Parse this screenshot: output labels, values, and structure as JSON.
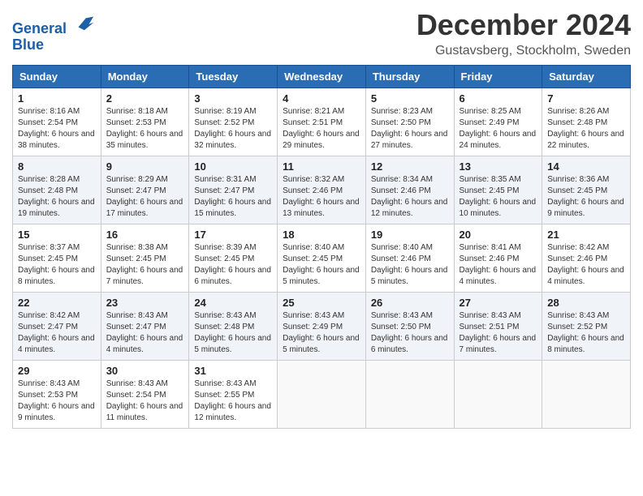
{
  "header": {
    "logo_line1": "General",
    "logo_line2": "Blue",
    "month_title": "December 2024",
    "location": "Gustavsberg, Stockholm, Sweden"
  },
  "days_of_week": [
    "Sunday",
    "Monday",
    "Tuesday",
    "Wednesday",
    "Thursday",
    "Friday",
    "Saturday"
  ],
  "weeks": [
    [
      {
        "day": "1",
        "sunrise": "8:16 AM",
        "sunset": "2:54 PM",
        "daylight": "6 hours and 38 minutes."
      },
      {
        "day": "2",
        "sunrise": "8:18 AM",
        "sunset": "2:53 PM",
        "daylight": "6 hours and 35 minutes."
      },
      {
        "day": "3",
        "sunrise": "8:19 AM",
        "sunset": "2:52 PM",
        "daylight": "6 hours and 32 minutes."
      },
      {
        "day": "4",
        "sunrise": "8:21 AM",
        "sunset": "2:51 PM",
        "daylight": "6 hours and 29 minutes."
      },
      {
        "day": "5",
        "sunrise": "8:23 AM",
        "sunset": "2:50 PM",
        "daylight": "6 hours and 27 minutes."
      },
      {
        "day": "6",
        "sunrise": "8:25 AM",
        "sunset": "2:49 PM",
        "daylight": "6 hours and 24 minutes."
      },
      {
        "day": "7",
        "sunrise": "8:26 AM",
        "sunset": "2:48 PM",
        "daylight": "6 hours and 22 minutes."
      }
    ],
    [
      {
        "day": "8",
        "sunrise": "8:28 AM",
        "sunset": "2:48 PM",
        "daylight": "6 hours and 19 minutes."
      },
      {
        "day": "9",
        "sunrise": "8:29 AM",
        "sunset": "2:47 PM",
        "daylight": "6 hours and 17 minutes."
      },
      {
        "day": "10",
        "sunrise": "8:31 AM",
        "sunset": "2:47 PM",
        "daylight": "6 hours and 15 minutes."
      },
      {
        "day": "11",
        "sunrise": "8:32 AM",
        "sunset": "2:46 PM",
        "daylight": "6 hours and 13 minutes."
      },
      {
        "day": "12",
        "sunrise": "8:34 AM",
        "sunset": "2:46 PM",
        "daylight": "6 hours and 12 minutes."
      },
      {
        "day": "13",
        "sunrise": "8:35 AM",
        "sunset": "2:45 PM",
        "daylight": "6 hours and 10 minutes."
      },
      {
        "day": "14",
        "sunrise": "8:36 AM",
        "sunset": "2:45 PM",
        "daylight": "6 hours and 9 minutes."
      }
    ],
    [
      {
        "day": "15",
        "sunrise": "8:37 AM",
        "sunset": "2:45 PM",
        "daylight": "6 hours and 8 minutes."
      },
      {
        "day": "16",
        "sunrise": "8:38 AM",
        "sunset": "2:45 PM",
        "daylight": "6 hours and 7 minutes."
      },
      {
        "day": "17",
        "sunrise": "8:39 AM",
        "sunset": "2:45 PM",
        "daylight": "6 hours and 6 minutes."
      },
      {
        "day": "18",
        "sunrise": "8:40 AM",
        "sunset": "2:45 PM",
        "daylight": "6 hours and 5 minutes."
      },
      {
        "day": "19",
        "sunrise": "8:40 AM",
        "sunset": "2:46 PM",
        "daylight": "6 hours and 5 minutes."
      },
      {
        "day": "20",
        "sunrise": "8:41 AM",
        "sunset": "2:46 PM",
        "daylight": "6 hours and 4 minutes."
      },
      {
        "day": "21",
        "sunrise": "8:42 AM",
        "sunset": "2:46 PM",
        "daylight": "6 hours and 4 minutes."
      }
    ],
    [
      {
        "day": "22",
        "sunrise": "8:42 AM",
        "sunset": "2:47 PM",
        "daylight": "6 hours and 4 minutes."
      },
      {
        "day": "23",
        "sunrise": "8:43 AM",
        "sunset": "2:47 PM",
        "daylight": "6 hours and 4 minutes."
      },
      {
        "day": "24",
        "sunrise": "8:43 AM",
        "sunset": "2:48 PM",
        "daylight": "6 hours and 5 minutes."
      },
      {
        "day": "25",
        "sunrise": "8:43 AM",
        "sunset": "2:49 PM",
        "daylight": "6 hours and 5 minutes."
      },
      {
        "day": "26",
        "sunrise": "8:43 AM",
        "sunset": "2:50 PM",
        "daylight": "6 hours and 6 minutes."
      },
      {
        "day": "27",
        "sunrise": "8:43 AM",
        "sunset": "2:51 PM",
        "daylight": "6 hours and 7 minutes."
      },
      {
        "day": "28",
        "sunrise": "8:43 AM",
        "sunset": "2:52 PM",
        "daylight": "6 hours and 8 minutes."
      }
    ],
    [
      {
        "day": "29",
        "sunrise": "8:43 AM",
        "sunset": "2:53 PM",
        "daylight": "6 hours and 9 minutes."
      },
      {
        "day": "30",
        "sunrise": "8:43 AM",
        "sunset": "2:54 PM",
        "daylight": "6 hours and 11 minutes."
      },
      {
        "day": "31",
        "sunrise": "8:43 AM",
        "sunset": "2:55 PM",
        "daylight": "6 hours and 12 minutes."
      },
      null,
      null,
      null,
      null
    ]
  ],
  "labels": {
    "sunrise": "Sunrise:",
    "sunset": "Sunset:",
    "daylight": "Daylight:"
  }
}
